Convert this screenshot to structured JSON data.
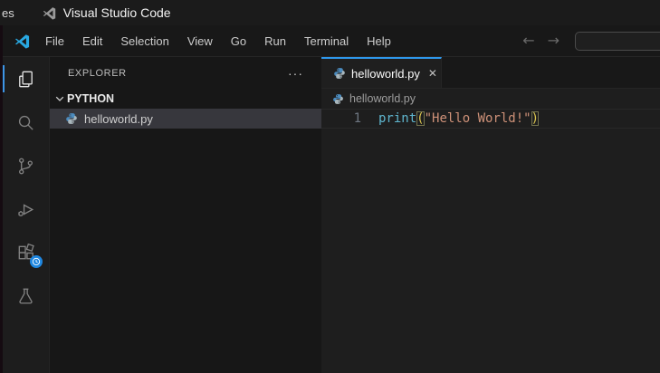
{
  "topbar": {
    "activities_partial": "es",
    "window_title": "Visual Studio Code"
  },
  "menubar": {
    "items": [
      "File",
      "Edit",
      "Selection",
      "View",
      "Go",
      "Run",
      "Terminal",
      "Help"
    ],
    "back_arrow": "←",
    "forward_arrow": "→",
    "search_value": ""
  },
  "activity_bar": {
    "items": [
      {
        "name": "explorer",
        "active": true
      },
      {
        "name": "search",
        "active": false
      },
      {
        "name": "source-control",
        "active": false
      },
      {
        "name": "run-and-debug",
        "active": false
      },
      {
        "name": "extensions",
        "active": false,
        "badge": "clock-progress"
      },
      {
        "name": "testing",
        "active": false
      }
    ]
  },
  "sidebar": {
    "title": "EXPLORER",
    "actions_label": "···",
    "section_label": "PYTHON",
    "files": [
      {
        "name": "helloworld.py",
        "selected": true
      }
    ]
  },
  "editor": {
    "tab": {
      "label": "helloworld.py",
      "close_label": "✕"
    },
    "breadcrumb": {
      "file": "helloworld.py"
    },
    "code": {
      "line_number": "1",
      "raw": "print(\"Hello World!\")",
      "tokens": {
        "function": "print",
        "open_paren": "(",
        "string": "\"Hello World!\"",
        "close_paren": ")"
      }
    }
  },
  "colors": {
    "accent_blue": "#2e97eb",
    "activity_indicator": "#3d95e6",
    "logo_blue": "#29a9e2",
    "badge_blue": "#1f87e0",
    "selection_bg": "#37373d",
    "function_color": "#5fb6cf",
    "string_color": "#ce9178",
    "bracket_color": "#dcc64f",
    "python_icon_blue": "#4b8bbe",
    "python_icon_silver": "#a9b7bd"
  }
}
